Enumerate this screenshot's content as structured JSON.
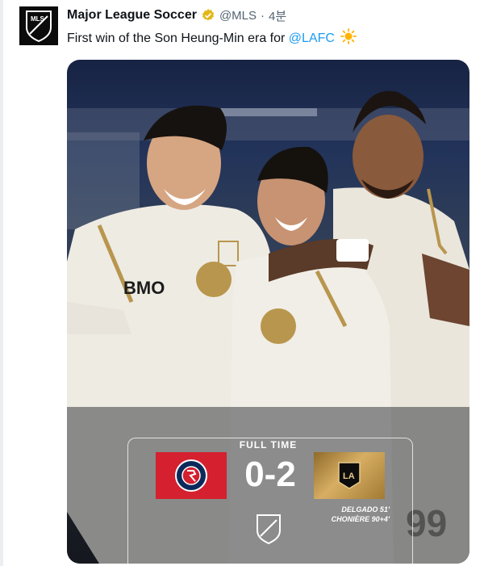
{
  "account": {
    "name": "Major League Soccer",
    "handle": "@MLS",
    "separator": "·",
    "time": "4분",
    "avatar_text": "MLS"
  },
  "tweet": {
    "text": "First win of the Son Heung-Min era for ",
    "mention": "@LAFC"
  },
  "graphic": {
    "status": "FULL TIME",
    "home_team": "New England Revolution",
    "home_score": "0",
    "away_score": "2",
    "score_separator": "-",
    "away_team": "LAFC",
    "scorers": [
      "DELGADO 51'",
      "CHONIÈRE 90+4'"
    ],
    "jersey_sponsor": "BMO",
    "jersey_number": "99"
  },
  "colors": {
    "home": "#d4202f",
    "away_gold": "#c39a4f",
    "link": "#1d9bf0",
    "verified": "#e2b719"
  }
}
